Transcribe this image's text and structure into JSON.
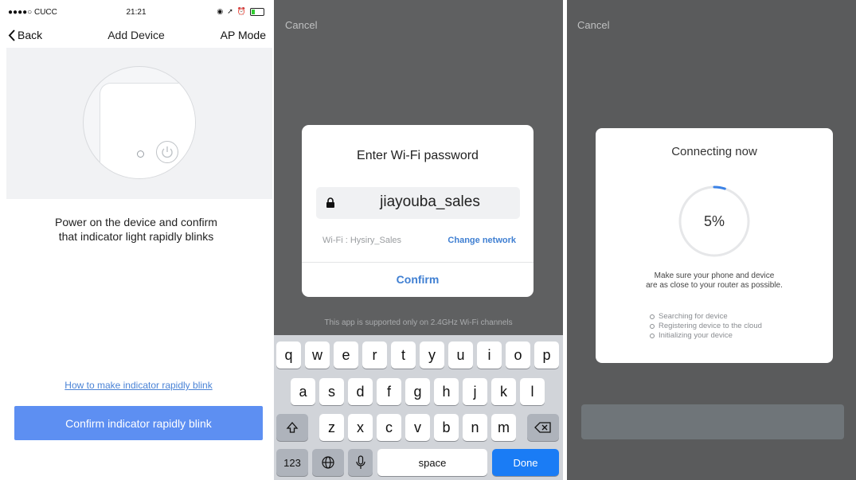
{
  "panel1": {
    "status": {
      "carrier": "●●●●○ CUCC",
      "time": "21:21"
    },
    "nav": {
      "back": "Back",
      "title": "Add Device",
      "right": "AP Mode"
    },
    "instruction_line1": "Power on the device and confirm",
    "instruction_line2": "that indicator light rapidly blinks",
    "help_link": "How to make indicator rapidly blink",
    "confirm_button": "Confirm indicator rapidly blink",
    "accent": "#5d8ff2"
  },
  "panel2": {
    "cancel": "Cancel",
    "dialog": {
      "title": "Enter Wi-Fi password",
      "password": "jiayouba_sales",
      "wifi_label": "Wi-Fi : Hysiry_Sales",
      "change_network": "Change network",
      "confirm": "Confirm"
    },
    "footnote": "This app is supported only on 2.4GHz Wi-Fi channels",
    "keyboard": {
      "row1": [
        "q",
        "w",
        "e",
        "r",
        "t",
        "y",
        "u",
        "i",
        "o",
        "p"
      ],
      "row2": [
        "a",
        "s",
        "d",
        "f",
        "g",
        "h",
        "j",
        "k",
        "l"
      ],
      "row3": [
        "z",
        "x",
        "c",
        "v",
        "b",
        "n",
        "m"
      ],
      "numbers": "123",
      "space": "space",
      "done": "Done"
    }
  },
  "panel3": {
    "cancel": "Cancel",
    "title": "Connecting now",
    "progress_label": "5%",
    "progress_fraction": 0.05,
    "note_line1": "Make sure your phone and device",
    "note_line2": "are as close to your router as possible.",
    "steps": [
      "Searching for device",
      "Registering device to the cloud",
      "Initializing your device"
    ]
  }
}
